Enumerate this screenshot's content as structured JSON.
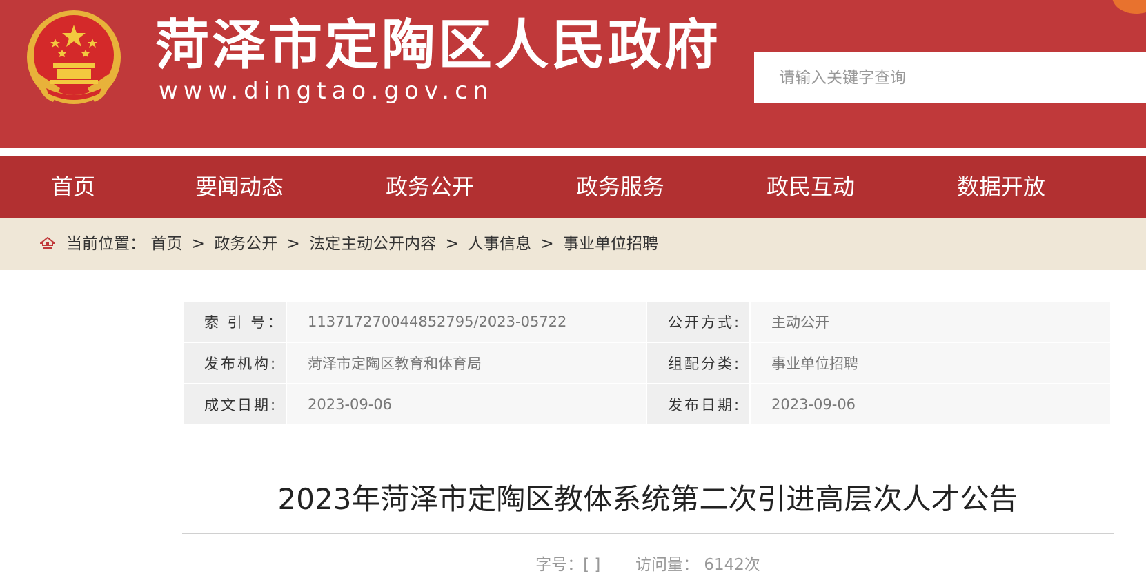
{
  "header": {
    "site_title": "菏泽市定陶区人民政府",
    "site_url": "www.dingtao.gov.cn",
    "search_placeholder": "请输入关键字查询"
  },
  "nav": {
    "items": [
      {
        "label": "首页"
      },
      {
        "label": "要闻动态"
      },
      {
        "label": "政务公开"
      },
      {
        "label": "政务服务"
      },
      {
        "label": "政民互动"
      },
      {
        "label": "数据开放"
      }
    ]
  },
  "breadcrumb": {
    "prefix": "当前位置：",
    "items": [
      "首页",
      "政务公开",
      "法定主动公开内容",
      "人事信息",
      "事业单位招聘"
    ],
    "separator": ">"
  },
  "meta": {
    "index_label": "索 引 号：",
    "index_value": "11371727004485279​5/2023-05722",
    "publicity_label": "公开方式:",
    "publicity_value": "主动公开",
    "issuer_label": "发布机构:",
    "issuer_value": "菏泽市定陶区教育和体育局",
    "category_label": "组配分类:",
    "category_value": "事业单位招聘",
    "written_date_label": "成文日期:",
    "written_date_value": "2023-09-06",
    "publish_date_label": "发布日期:",
    "publish_date_value": "2023-09-06"
  },
  "article": {
    "title": "2023年菏泽市定陶区教体系统第二次引进高层次人才公告",
    "font_size_label": "字号：[ ]",
    "views_label": "访问量：",
    "views_value": "6142次"
  },
  "colors": {
    "header_red": "#c0393a",
    "nav_red": "#b23031",
    "breadcrumb_beige": "#efe7d7"
  }
}
